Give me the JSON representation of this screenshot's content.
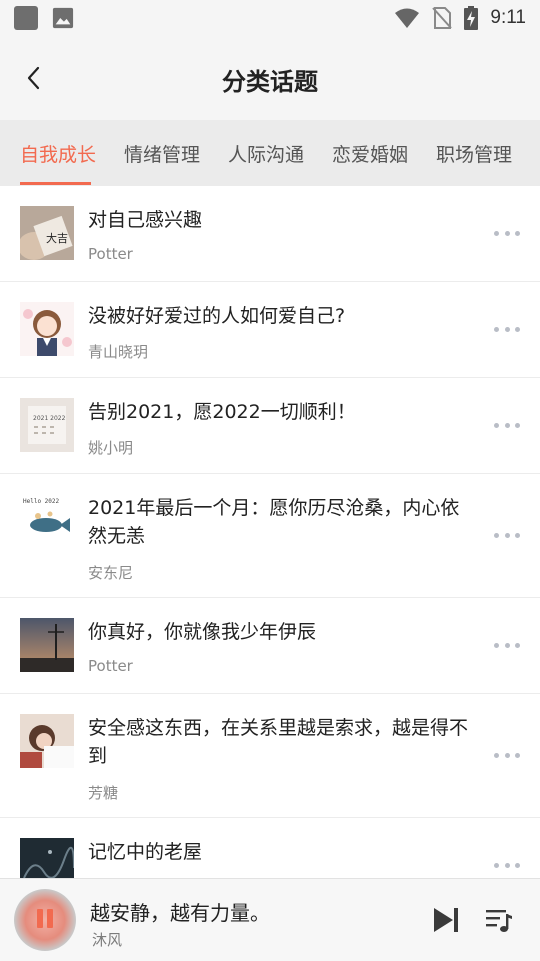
{
  "status_bar": {
    "time": "9:11",
    "icons": [
      "square-icon",
      "image-icon",
      "wifi-icon",
      "no-sim-icon",
      "battery-charging-icon"
    ]
  },
  "header": {
    "back_icon": "chevron-left-icon",
    "title": "分类话题"
  },
  "tabs": [
    {
      "label": "自我成长",
      "active": true
    },
    {
      "label": "情绪管理",
      "active": false
    },
    {
      "label": "人际沟通",
      "active": false
    },
    {
      "label": "恋爱婚姻",
      "active": false
    },
    {
      "label": "职场管理",
      "active": false
    }
  ],
  "topics": [
    {
      "title": "对自己感兴趣",
      "author": "Potter",
      "more_icon": "more-dots-icon"
    },
    {
      "title": "没被好好爱过的人如何爱自己?",
      "author": "青山晓玥",
      "more_icon": "more-dots-icon"
    },
    {
      "title": "告别2021，愿2022一切顺利！",
      "author": "姚小明",
      "more_icon": "more-dots-icon"
    },
    {
      "title": "2021年最后一个月：愿你历尽沧桑，内心依然无恙",
      "author": "安东尼",
      "more_icon": "more-dots-icon"
    },
    {
      "title": "你真好，你就像我少年伊辰",
      "author": "Potter",
      "more_icon": "more-dots-icon"
    },
    {
      "title": "安全感这东西，在关系里越是索求，越是得不到",
      "author": "芳糖",
      "more_icon": "more-dots-icon"
    },
    {
      "title": "记忆中的老屋",
      "author": "",
      "more_icon": "more-dots-icon"
    }
  ],
  "thumb_text": {
    "0": "大吉",
    "2": "2021 2022",
    "3": "Hello 2022"
  },
  "player": {
    "title": "越安静，越有力量。",
    "artist": "沐风",
    "state": "playing",
    "icons": [
      "pause-icon",
      "skip-next-icon",
      "playlist-icon"
    ]
  },
  "colors": {
    "accent": "#f26a4f",
    "tab_bg": "#ebebeb",
    "header_bg": "#f5f5f5",
    "muted_text": "#8a8a8a"
  }
}
